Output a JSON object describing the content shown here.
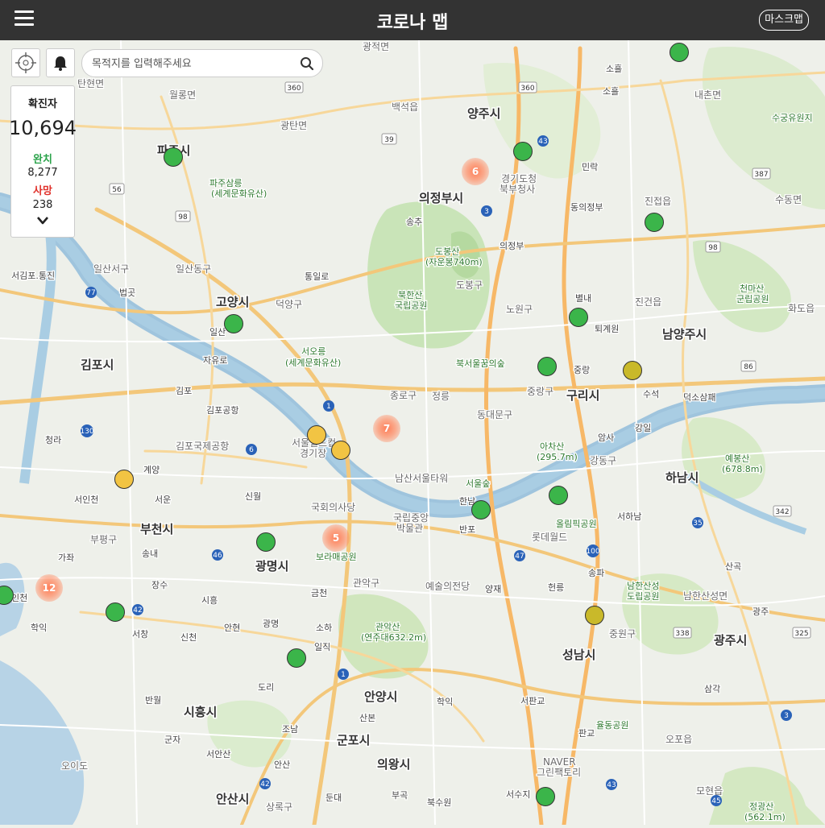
{
  "header": {
    "title": "코로나 맵",
    "mask_button": "마스크맵"
  },
  "search": {
    "placeholder": "목적지를 입력해주세요"
  },
  "stats": {
    "confirmed_label": "확진자",
    "confirmed_value": "10,694",
    "recovered_label": "완치",
    "recovered_value": "8,277",
    "death_label": "사망",
    "death_value": "238"
  },
  "clusters": [
    "6",
    "7",
    "5",
    "12"
  ],
  "map_labels": {
    "cities": [
      "파주시",
      "양주시",
      "의정부시",
      "고양시",
      "김포시",
      "구리시",
      "남양주시",
      "하남시",
      "부천시",
      "광명시",
      "성남시",
      "광주시",
      "시흥시",
      "안양시",
      "군포시",
      "의왕시",
      "안산시"
    ],
    "towns": [
      "월롱면",
      "광탄면",
      "백석읍",
      "탄현면",
      "일산서구",
      "일산동구",
      "덕양구",
      "도봉구",
      "노원구",
      "중랑구",
      "종로구",
      "동대문구",
      "강동구",
      "진건읍",
      "진접읍",
      "화도읍",
      "부평구",
      "관악구",
      "중원구",
      "남한산성면",
      "오포읍",
      "모현읍",
      "상록구",
      "오이도",
      "내촌면",
      "수동면",
      "광적면"
    ],
    "parks": [
      "파주삼릉",
      "(세계문화유산)",
      "도봉산",
      "(자운봉740m)",
      "북한산",
      "국립공원",
      "서오릉",
      "(세계문화유산)",
      "북서울꿈의숲",
      "아차산",
      "(295.7m)",
      "천마산",
      "군립공원",
      "예봉산",
      "(678.8m)",
      "보라매공원",
      "관악산",
      "(연주대632.2m)",
      "남한산성",
      "도립공원",
      "율동공원",
      "올림픽공원",
      "서울숲",
      "정광산",
      "(562.1m)",
      "수궁유원지",
      "경기도청",
      "북부청사",
      "남산서울타워",
      "국립중앙",
      "박물관",
      "예술의전당",
      "국회의사당",
      "서울월드컵",
      "경기장",
      "김포국제공항",
      "롯데월드",
      "정릉",
      "NAVER",
      "그린팩토리"
    ],
    "ics": [
      "소흘",
      "소흘",
      "민락",
      "동의정부",
      "송추",
      "의정부",
      "통일로",
      "자유로",
      "일산",
      "법곳",
      "서김포.통진",
      "퇴계원",
      "별내",
      "중랑",
      "수석",
      "덕소삼패",
      "강일",
      "암사",
      "서하남",
      "청라",
      "계양",
      "서인천",
      "김포",
      "김포공항",
      "서운",
      "신월",
      "가좌",
      "송내",
      "장수",
      "시흥",
      "안현",
      "광명",
      "소하",
      "금천",
      "신천",
      "인천",
      "서창",
      "학익",
      "일직",
      "도리",
      "조남",
      "안산",
      "군자",
      "서안산",
      "반월",
      "둔대",
      "부곡",
      "북수원",
      "산본",
      "학익",
      "서판교",
      "서수지",
      "판교",
      "송파",
      "헌릉",
      "양재",
      "반포",
      "한남",
      "삼각",
      "산곡",
      "광주"
    ],
    "roads": [
      "360",
      "360",
      "43",
      "39",
      "3",
      "56",
      "98",
      "387",
      "98",
      "77",
      "1",
      "6",
      "130",
      "46",
      "42",
      "100",
      "47",
      "35",
      "86",
      "342",
      "338",
      "325",
      "43",
      "45",
      "1",
      "42",
      "3"
    ]
  },
  "colors": {
    "header_bg": "#333333",
    "confirmed": "#222222",
    "recovered": "#2aa34a",
    "death": "#e0302a",
    "marker_green": "#3bb54a",
    "marker_yellow": "#f2c443",
    "cluster": "#ff7850"
  }
}
